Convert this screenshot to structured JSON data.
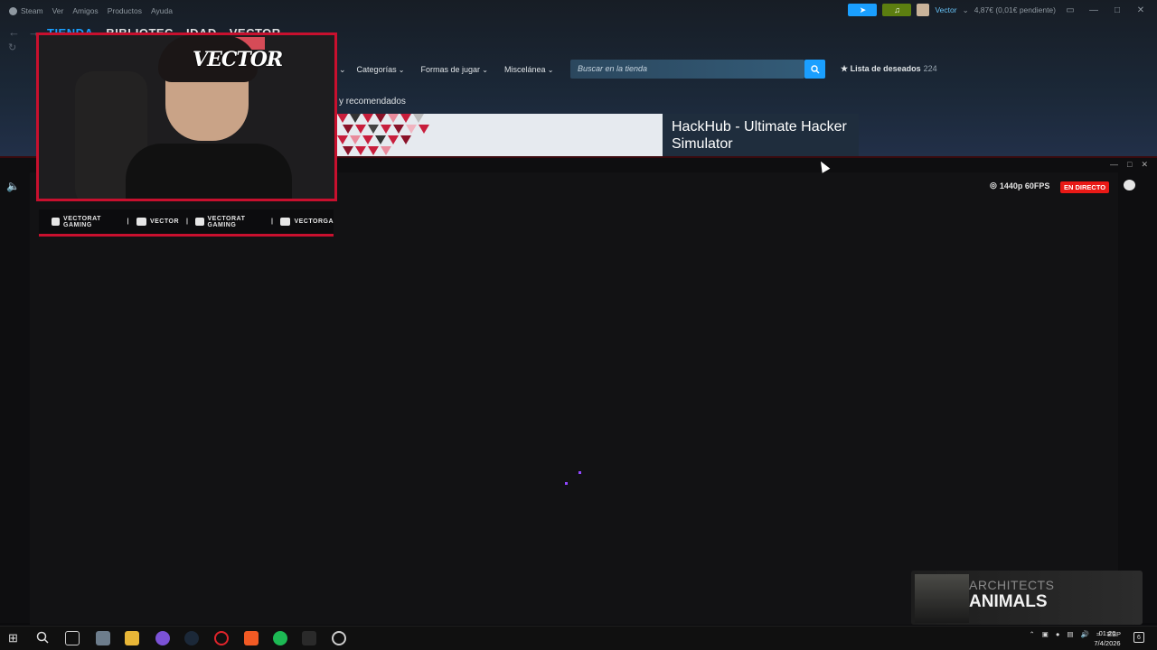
{
  "steam": {
    "menu": [
      "Steam",
      "Ver",
      "Amigos",
      "Productos",
      "Ayuda"
    ],
    "account": {
      "name": "Vector",
      "wallet": "4,87€ (0,01€ pendiente)"
    },
    "tabs": {
      "store": "TIENDA",
      "library": "BIBLIOTEC",
      "community": "IDAD",
      "user": "VECTOR"
    },
    "store_nav": {
      "categories": "Categorías",
      "play_modes": "Formas de jugar",
      "misc": "Miscelánea"
    },
    "search_placeholder": "Buscar en la tienda",
    "wishlist": {
      "label": "Lista de deseados",
      "count": "224"
    },
    "recommended": "y recomendados",
    "featured_title": "HackHub - Ultimate Hacker Simulator"
  },
  "stream": {
    "quality": "1440p 60FPS",
    "live": "EN DIRECTO"
  },
  "cam": {
    "logo": "VECTOR",
    "socials": [
      {
        "icon": "youtube-icon",
        "label": "VECTORAT GAMING"
      },
      {
        "icon": "twitch-icon",
        "label": "VECTOR"
      },
      {
        "icon": "twitter-icon",
        "label": "VECTORAT GAMING"
      },
      {
        "icon": "instagram-icon",
        "label": "VECTORGA"
      }
    ]
  },
  "game_overlay": {
    "pre": "ARCHITECTS",
    "title": "ANIMALS"
  },
  "taskbar": {
    "lang": "ESP",
    "time": "01:20",
    "date": "7/4/2026",
    "notifications": "6"
  },
  "colors": {
    "steam_accent": "#1a9fff",
    "live_red": "#e91916",
    "cam_border": "#c8102e"
  }
}
